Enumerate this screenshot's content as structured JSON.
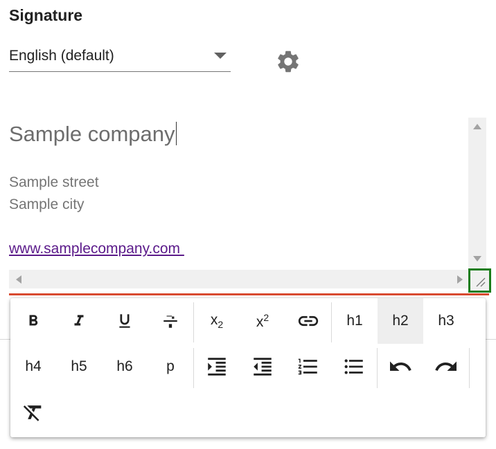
{
  "section": {
    "title": "Signature"
  },
  "language": {
    "selected": "English (default)"
  },
  "settings": {
    "icon": "gear-icon"
  },
  "editor": {
    "company": "Sample company",
    "street": "Sample street",
    "city": "Sample city",
    "website": "www.samplecompany.com "
  },
  "toolbar": {
    "h1": "h1",
    "h2": "h2",
    "h3": "h3",
    "h4": "h4",
    "h5": "h5",
    "h6": "h6",
    "p": "p",
    "subscript_base": "x",
    "subscript_mark": "2",
    "superscript_base": "x",
    "superscript_mark": "2",
    "active_item": "h2"
  },
  "colors": {
    "focus_underline": "#d84a30",
    "resize_highlight": "#1b7d1b",
    "link": "#5b1a8a"
  }
}
